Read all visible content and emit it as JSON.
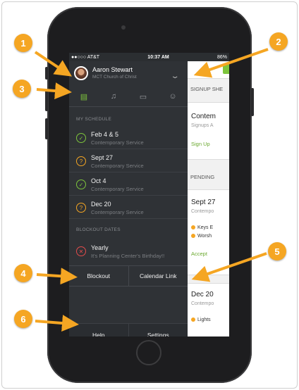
{
  "status_bar": {
    "carrier": "●●○○○ AT&T",
    "time": "10:37 AM",
    "battery": "86%"
  },
  "profile": {
    "name": "Aaron Stewart",
    "org": "MCT Church of Christ"
  },
  "tabs": [
    {
      "icon": "clipboard-icon",
      "glyph": "▤"
    },
    {
      "icon": "music-note-icon",
      "glyph": "♫"
    },
    {
      "icon": "video-icon",
      "glyph": "▭"
    },
    {
      "icon": "people-icon",
      "glyph": "☺"
    }
  ],
  "schedule": {
    "heading": "MY SCHEDULE",
    "items": [
      {
        "title": "Feb 4 & 5",
        "subtitle": "Contemporary Service",
        "status": "✓"
      },
      {
        "title": "Sept 27",
        "subtitle": "Contemporary Service",
        "status": "?"
      },
      {
        "title": "Oct 4",
        "subtitle": "Contemporary Service",
        "status": "✓"
      },
      {
        "title": "Dec 20",
        "subtitle": "Contemporary Service",
        "status": "?"
      }
    ]
  },
  "blockout": {
    "heading": "BLOCKOUT DATES",
    "item": {
      "title": "Yearly",
      "subtitle": "It's Planning Center's Birthday!!",
      "status": "✕"
    }
  },
  "actions": {
    "blockout": "Blockout",
    "calendar_link": "Calendar Link"
  },
  "footer": {
    "help": "Help",
    "settings": "Settings"
  },
  "main": {
    "signup_heading": "SIGNUP SHE",
    "signup_card": {
      "title": "Contem",
      "subtitle": "Signups A",
      "action": "Sign Up"
    },
    "pending_heading": "PENDING",
    "pending_card1": {
      "title": "Sept 27",
      "subtitle": "Contempo",
      "line1": "Keys",
      "line1b": "E",
      "line2": "Worsh",
      "action": "Accept"
    },
    "pending_card2": {
      "title": "Dec 20",
      "subtitle": "Contempo",
      "line1": "Lights"
    }
  },
  "callouts": [
    "1",
    "2",
    "3",
    "4",
    "5",
    "6"
  ],
  "colors": {
    "accent_green": "#7ec53c",
    "callout_orange": "#f5a623",
    "drawer_bg": "#2f3236"
  }
}
